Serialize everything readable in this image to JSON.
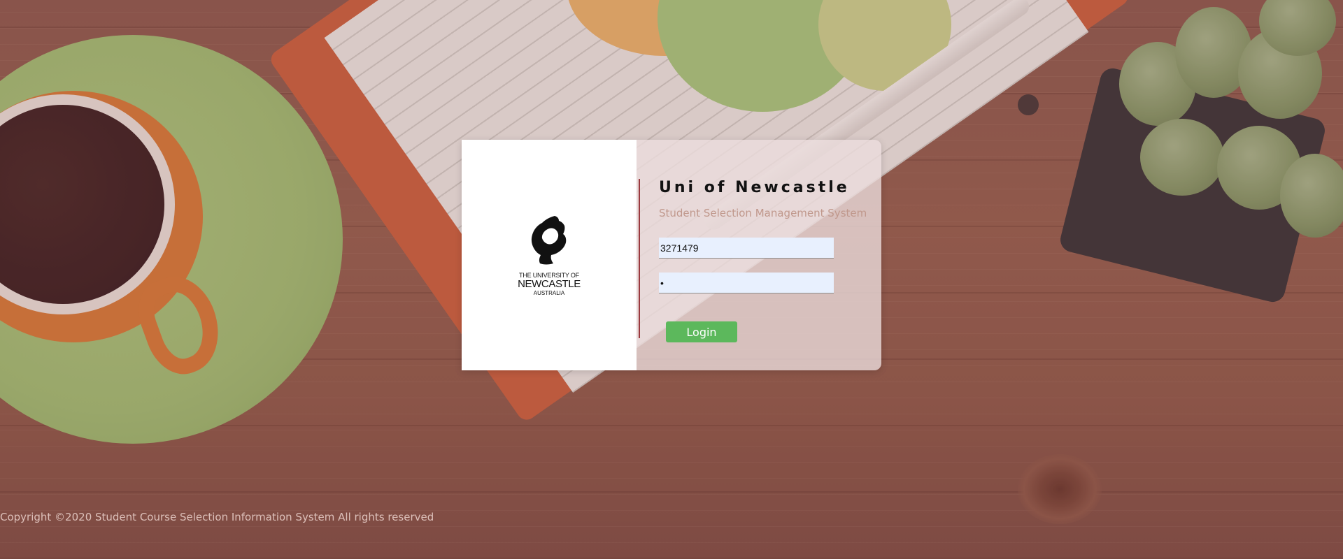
{
  "logo": {
    "icon": "horse-head-emblem",
    "line1": "THE UNIVERSITY OF",
    "line2": "NEWCASTLE",
    "line3": "AUSTRALIA"
  },
  "login": {
    "title": "Uni of Newcastle",
    "subtitle": "Student Selection Management System",
    "username_value": "3271479",
    "password_value": "•",
    "button_label": "Login"
  },
  "footer": {
    "copyright": "Copyright ©2020 Student Course Selection Information System All rights reserved"
  },
  "colors": {
    "button": "#5cb85c",
    "divider": "#9b3a3f",
    "subtitle": "#c0988c",
    "input_bg": "#e8f0fe"
  }
}
